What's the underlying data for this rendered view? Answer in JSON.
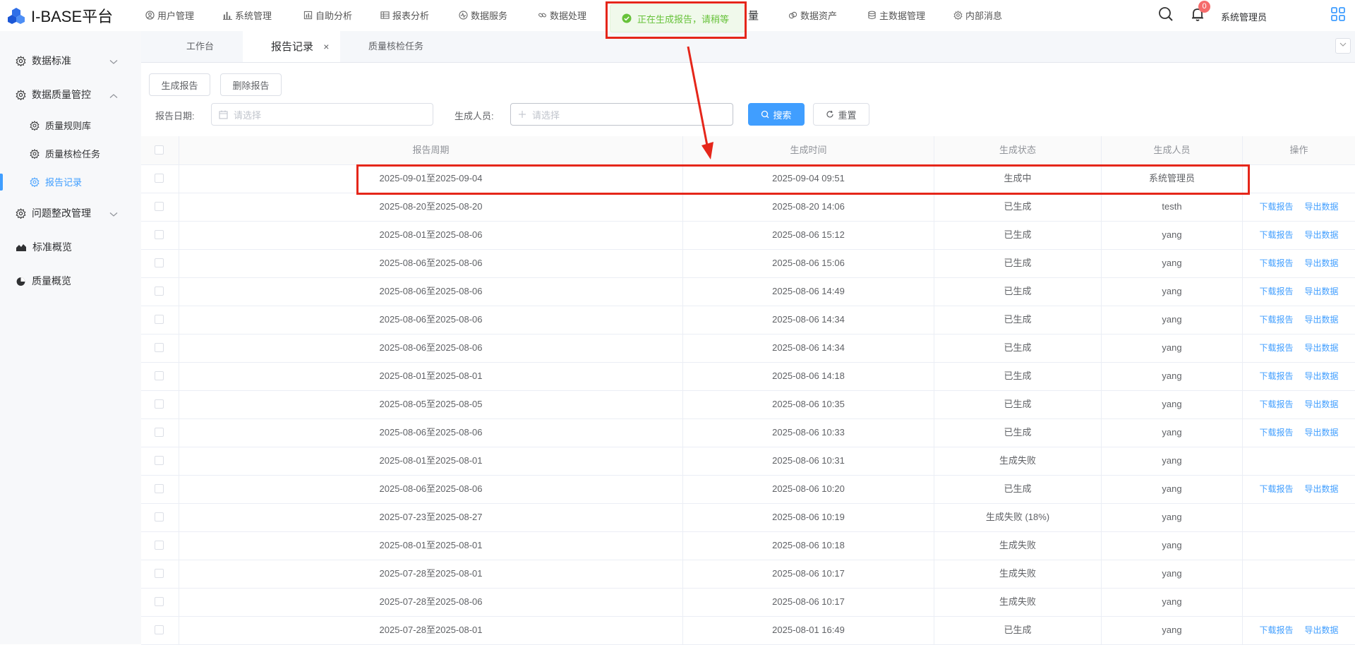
{
  "app": {
    "title": "I-BASE平台",
    "accent": "#409eff",
    "notification_count": "0",
    "user": "系统管理员"
  },
  "nav": [
    {
      "label": "用户管理",
      "icon": "user-circle-icon"
    },
    {
      "label": "系统管理",
      "icon": "bar-chart-icon"
    },
    {
      "label": "自助分析",
      "icon": "column-chart-icon"
    },
    {
      "label": "报表分析",
      "icon": "table-icon"
    },
    {
      "label": "数据服务",
      "icon": "activity-icon"
    },
    {
      "label": "数据处理",
      "icon": "link-icon"
    },
    {
      "label": "量",
      "icon": ""
    },
    {
      "label": "数据资产",
      "icon": "coins-icon"
    },
    {
      "label": "主数据管理",
      "icon": "database-icon"
    },
    {
      "label": "内部消息",
      "icon": "gear-icon"
    }
  ],
  "toast": {
    "message": "正在生成报告，请稍等"
  },
  "sidebar": {
    "items": [
      {
        "label": "数据标准",
        "icon": "gear-icon"
      },
      {
        "label": "数据质量管控",
        "icon": "gear-icon"
      },
      {
        "label": "质量规则库",
        "icon": "gear-icon"
      },
      {
        "label": "质量核检任务",
        "icon": "gear-icon"
      },
      {
        "label": "报告记录",
        "icon": "gear-icon"
      },
      {
        "label": "问题整改管理",
        "icon": "gear-icon"
      },
      {
        "label": "标准概览",
        "icon": "area-chart-icon"
      },
      {
        "label": "质量概览",
        "icon": "pie-chart-icon"
      }
    ]
  },
  "tabs": [
    {
      "label": "工作台"
    },
    {
      "label": "报告记录",
      "close": "×"
    },
    {
      "label": "质量核检任务"
    }
  ],
  "toolbar": {
    "generate": "生成报告",
    "delete": "删除报告",
    "date_label": "报告日期:",
    "date_placeholder": "请选择",
    "creator_label": "生成人员:",
    "creator_placeholder": "请选择",
    "search": "搜索",
    "reset": "重置"
  },
  "table": {
    "columns": [
      "报告周期",
      "生成时间",
      "生成状态",
      "生成人员",
      "操作"
    ],
    "download_label": "下载报告",
    "export_label": "导出数据",
    "rows": [
      {
        "period": "2025-09-01至2025-09-04",
        "time": "2025-09-04 09:51",
        "status": "生成中",
        "user": "系统管理员",
        "actions": false
      },
      {
        "period": "2025-08-20至2025-08-20",
        "time": "2025-08-20 14:06",
        "status": "已生成",
        "user": "testh",
        "actions": true
      },
      {
        "period": "2025-08-01至2025-08-06",
        "time": "2025-08-06 15:12",
        "status": "已生成",
        "user": "yang",
        "actions": true
      },
      {
        "period": "2025-08-06至2025-08-06",
        "time": "2025-08-06 15:06",
        "status": "已生成",
        "user": "yang",
        "actions": true
      },
      {
        "period": "2025-08-06至2025-08-06",
        "time": "2025-08-06 14:49",
        "status": "已生成",
        "user": "yang",
        "actions": true
      },
      {
        "period": "2025-08-06至2025-08-06",
        "time": "2025-08-06 14:34",
        "status": "已生成",
        "user": "yang",
        "actions": true
      },
      {
        "period": "2025-08-06至2025-08-06",
        "time": "2025-08-06 14:34",
        "status": "已生成",
        "user": "yang",
        "actions": true
      },
      {
        "period": "2025-08-01至2025-08-01",
        "time": "2025-08-06 14:18",
        "status": "已生成",
        "user": "yang",
        "actions": true
      },
      {
        "period": "2025-08-05至2025-08-05",
        "time": "2025-08-06 10:35",
        "status": "已生成",
        "user": "yang",
        "actions": true
      },
      {
        "period": "2025-08-06至2025-08-06",
        "time": "2025-08-06 10:33",
        "status": "已生成",
        "user": "yang",
        "actions": true
      },
      {
        "period": "2025-08-01至2025-08-01",
        "time": "2025-08-06 10:31",
        "status": "生成失败",
        "user": "yang",
        "actions": false
      },
      {
        "period": "2025-08-06至2025-08-06",
        "time": "2025-08-06 10:20",
        "status": "已生成",
        "user": "yang",
        "actions": true
      },
      {
        "period": "2025-07-23至2025-08-27",
        "time": "2025-08-06 10:19",
        "status": "生成失败 (18%)",
        "user": "yang",
        "actions": false
      },
      {
        "period": "2025-08-01至2025-08-01",
        "time": "2025-08-06 10:18",
        "status": "生成失败",
        "user": "yang",
        "actions": false
      },
      {
        "period": "2025-07-28至2025-08-01",
        "time": "2025-08-06 10:17",
        "status": "生成失败",
        "user": "yang",
        "actions": false
      },
      {
        "period": "2025-07-28至2025-08-06",
        "time": "2025-08-06 10:17",
        "status": "生成失败",
        "user": "yang",
        "actions": false
      },
      {
        "period": "2025-07-28至2025-08-01",
        "time": "2025-08-01 16:49",
        "status": "已生成",
        "user": "yang",
        "actions": true
      }
    ]
  }
}
